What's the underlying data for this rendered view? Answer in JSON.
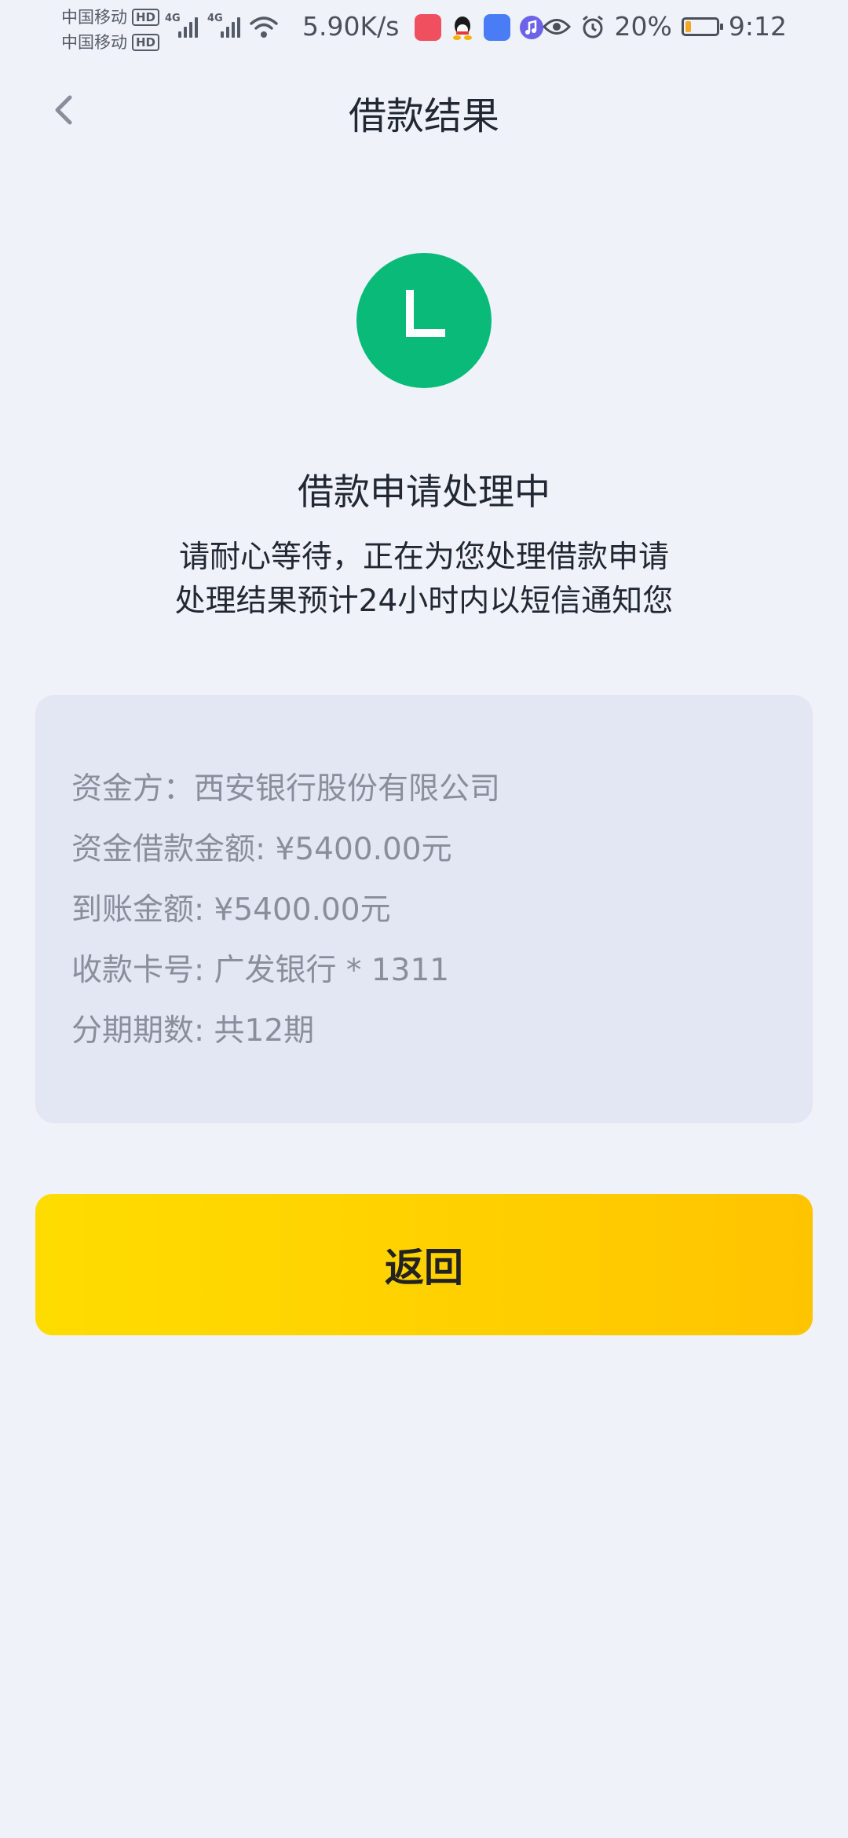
{
  "status_bar": {
    "carrier_1": "中国移动",
    "carrier_2": "中国移动",
    "hd_label": "HD",
    "net_label": "4G",
    "speed": "5.90K/s",
    "battery_percent": "20%",
    "battery_level": 0.2,
    "time": "9:12"
  },
  "header": {
    "title": "借款结果"
  },
  "status": {
    "badge_letter": "L",
    "badge_color": "#09ba79",
    "title": "借款申请处理中",
    "desc_line1": "请耐心等待，正在为您处理借款申请",
    "desc_line2": "处理结果预计24小时内以短信通知您"
  },
  "info": {
    "funder": "资金方：西安银行股份有限公司",
    "loan_amount": "资金借款金额: ¥5400.00元",
    "received_amount": "到账金额: ¥5400.00元",
    "card_number": "收款卡号: 广发银行 * 1311",
    "installments": "分期期数: 共12期"
  },
  "actions": {
    "return_label": "返回"
  },
  "colors": {
    "background": "#eff2f9",
    "card": "#e3e6f3",
    "accent_yellow": "#ffd000",
    "success_green": "#09ba79"
  }
}
